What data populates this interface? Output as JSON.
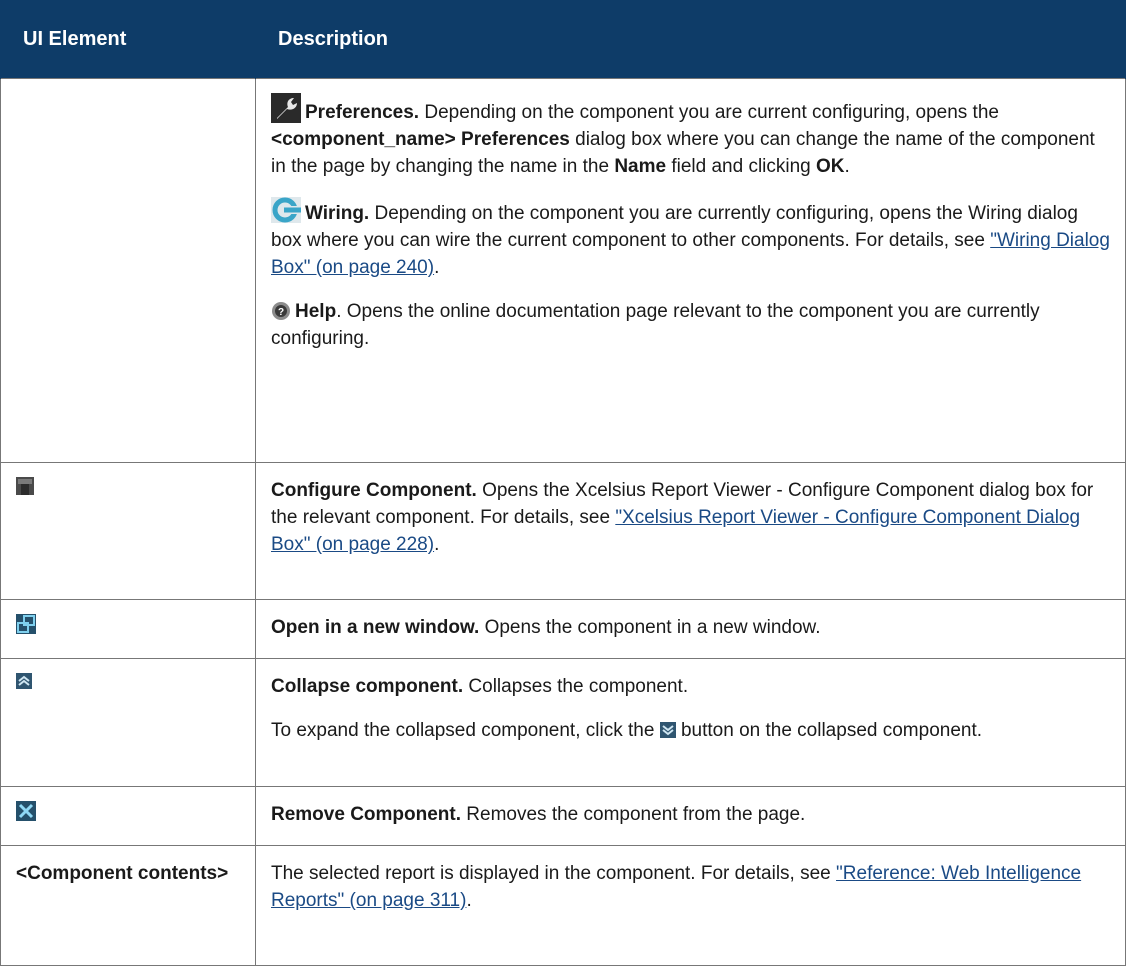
{
  "header": {
    "col1": "UI Element",
    "col2": "Description"
  },
  "row1": {
    "preferences": {
      "title": "Preferences.",
      "text_a": " Depending on the component you are current configuring, opens the ",
      "bold_a": "<component_name> Preferences",
      "text_b": " dialog box where you can change the name of the component in the page by changing the name in the ",
      "bold_b": "Name",
      "text_c": " field and clicking ",
      "bold_c": "OK",
      "text_d": "."
    },
    "wiring": {
      "title": "Wiring.",
      "text_a": " Depending on the component you are currently configuring, opens the Wiring dialog box where you can wire the current component to other components. For details, see ",
      "link": "\"Wiring Dialog Box\" (on page 240)",
      "text_b": "."
    },
    "help": {
      "title": "Help",
      "text_a": ". Opens the online documentation page relevant to the component you are currently configuring."
    }
  },
  "row2": {
    "icon": "configure-icon",
    "title": "Configure Component.",
    "text_a": " Opens the Xcelsius Report Viewer - Configure Component dialog box for the relevant component. For details, see ",
    "link": "\"Xcelsius Report Viewer - Configure Component Dialog Box\" (on page 228)",
    "text_b": "."
  },
  "row3": {
    "icon": "new-window-icon",
    "title": "Open in a new window.",
    "text_a": " Opens the component in a new window."
  },
  "row4": {
    "icon": "collapse-icon",
    "title": "Collapse component.",
    "text_a": " Collapses the component.",
    "text_b": "To expand the collapsed component, click the ",
    "text_c": " button on the collapsed component."
  },
  "row5": {
    "icon": "remove-icon",
    "title": "Remove Component.",
    "text_a": " Removes the component from the page."
  },
  "row6": {
    "element": "<Component contents>",
    "text_a": "The selected report is displayed in the component. For details, see ",
    "link": "\"Reference: Web Intelligence Reports\" (on page 311)",
    "text_b": "."
  },
  "colors": {
    "header_bg": "#0e3c68",
    "link": "#1a4a85",
    "border": "#777777"
  }
}
